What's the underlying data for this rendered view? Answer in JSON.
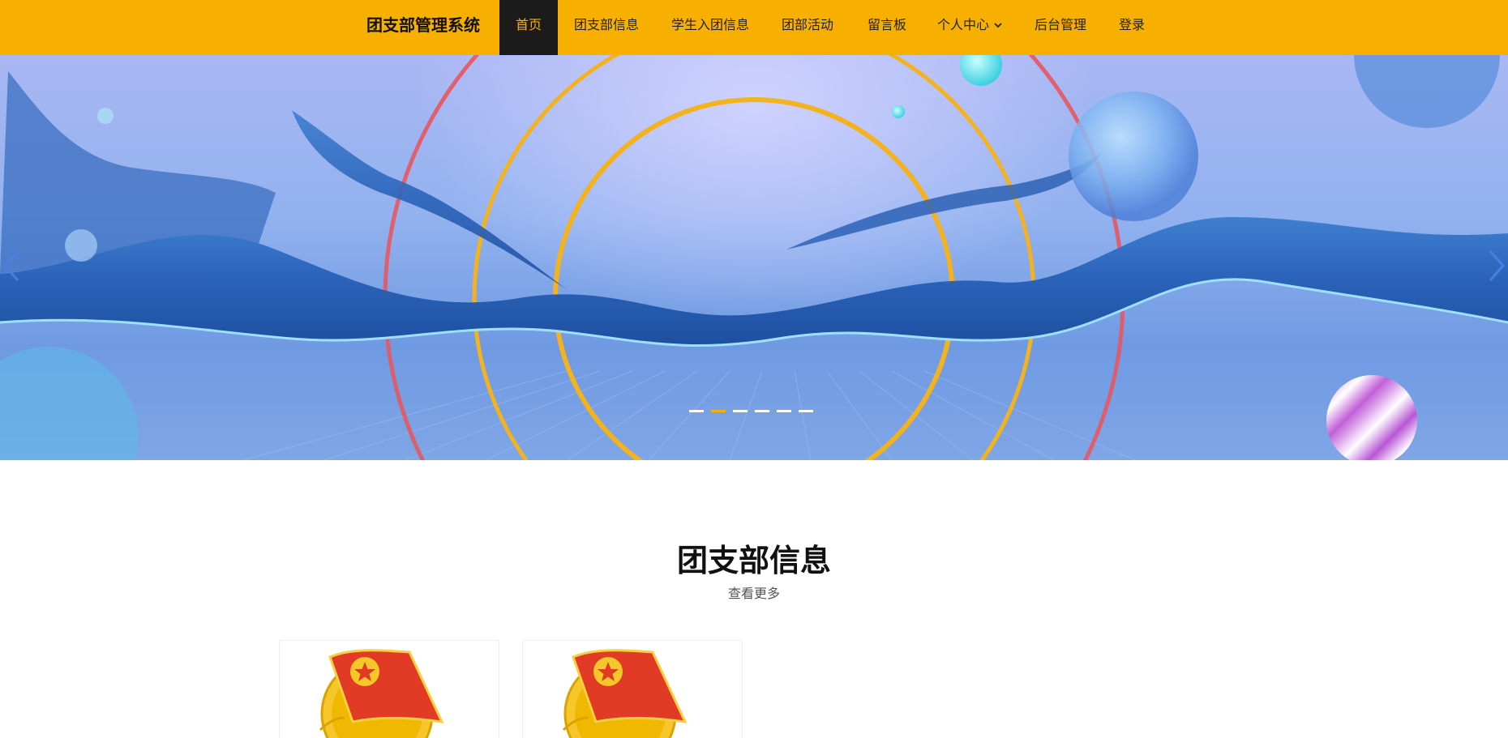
{
  "navbar": {
    "brand": "团支部管理系统",
    "items": [
      {
        "label": "首页",
        "active": true
      },
      {
        "label": "团支部信息"
      },
      {
        "label": "学生入团信息"
      },
      {
        "label": "团部活动"
      },
      {
        "label": "留言板"
      },
      {
        "label": "个人中心",
        "has_dropdown": true
      },
      {
        "label": "后台管理"
      },
      {
        "label": "登录"
      }
    ],
    "accent_color": "#f7b000",
    "active_bg": "#1b1b1b"
  },
  "hero": {
    "slide_count": 6,
    "active_slide": 2,
    "prev_icon": "chevron-left-icon",
    "next_icon": "chevron-right-icon"
  },
  "section": {
    "title": "团支部信息",
    "more_label": "查看更多",
    "cards": [
      {
        "image_icon": "youth-league-emblem-icon"
      },
      {
        "image_icon": "youth-league-emblem-icon"
      }
    ]
  }
}
